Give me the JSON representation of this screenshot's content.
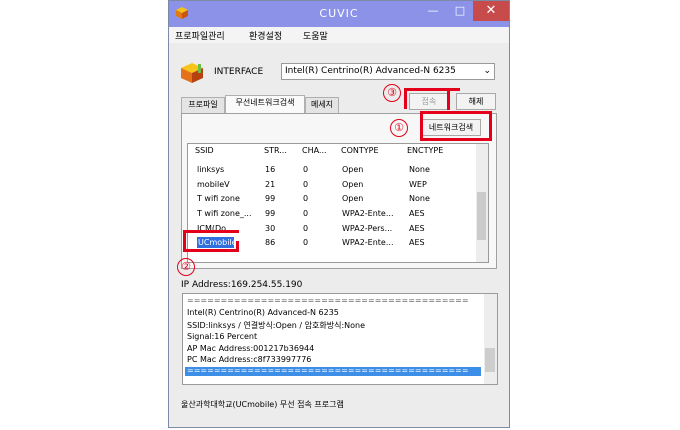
{
  "window": {
    "title": "CUVIC",
    "min": "—",
    "max": "□",
    "close": "✕"
  },
  "menu": [
    "프로파일관리",
    "환경설정",
    "도움말"
  ],
  "interface": {
    "label": "INTERFACE",
    "value": "Intel(R) Centrino(R) Advanced-N 6235"
  },
  "tabs": [
    "프로파일",
    "무선네트워크검색",
    "메세지"
  ],
  "buttons": {
    "connect": "접속",
    "release": "해제",
    "scan": "네트워크검색"
  },
  "table": {
    "headers": [
      "SSID",
      "STR...",
      "CHA...",
      "CONTYPE",
      "ENCTYPE"
    ],
    "rows": [
      [
        "linksys",
        "16",
        "0",
        "Open",
        "None"
      ],
      [
        "mobileV",
        "21",
        "0",
        "Open",
        "WEP"
      ],
      [
        "T wifi zone",
        "99",
        "0",
        "Open",
        "None"
      ],
      [
        "T wifi zone_...",
        "99",
        "0",
        "WPA2-Ente...",
        "AES"
      ],
      [
        "ICM(Do...",
        "30",
        "0",
        "WPA2-Pers...",
        "AES"
      ],
      [
        "UCmobile",
        "86",
        "0",
        "WPA2-Ente...",
        "AES"
      ]
    ]
  },
  "ip_text": "IP Address:169.254.55.190",
  "log": {
    "lines": [
      "==========================================",
      "Intel(R) Centrino(R) Advanced-N 6235",
      "SSID:linksys / 연결방식:Open / 암호화방식:None",
      "Signal:16 Percent",
      "AP Mac Address:001217b36944",
      "PC Mac Address:c8f733997776",
      "=========================================="
    ]
  },
  "footer": "울산과학대학교(UCmobile) 무선 접속 프로그램",
  "annotations": {
    "one": "①",
    "two": "②",
    "three": "③"
  },
  "colors": {
    "titlebar": "#8b92e8",
    "close": "#c74b4b",
    "selection": "#2f6fe0",
    "annotation": "#e4001b"
  }
}
